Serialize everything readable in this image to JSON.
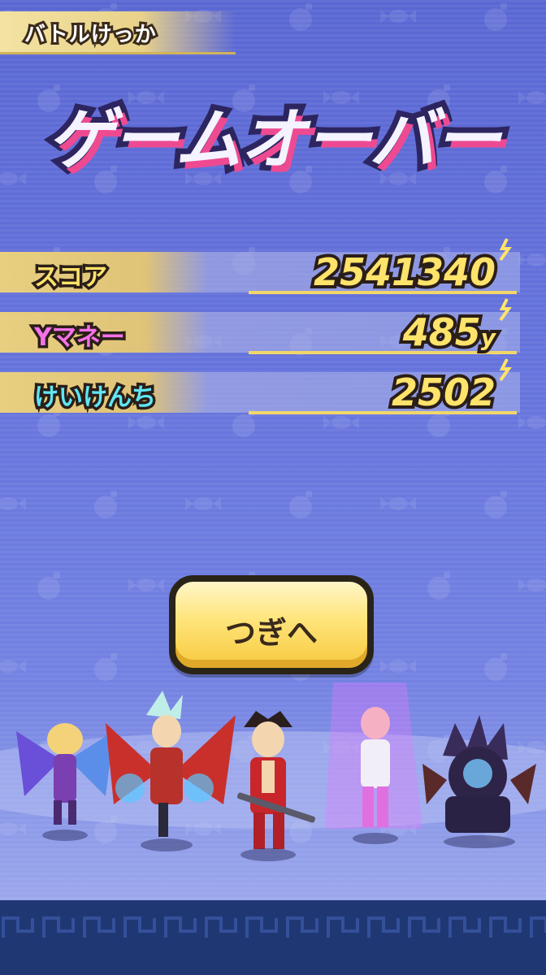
{
  "header": {
    "title": "バトルけっか"
  },
  "result": {
    "title": "ゲームオーバー"
  },
  "stats": [
    {
      "label": "スコア",
      "value": "2541340",
      "unit": "",
      "label_color": "#ffe36a"
    },
    {
      "label": "Yマネー",
      "value": "485",
      "unit": "y",
      "label_color": "#f472e8"
    },
    {
      "label": "けいけんち",
      "value": "2502",
      "unit": "",
      "label_color": "#5fe6f4"
    }
  ],
  "next_button": {
    "label": "つぎへ"
  },
  "colors": {
    "accent_gold": "#ffe36a",
    "title_shadow": "#ee4a92",
    "background": "#5f6fd6",
    "floor": "#1f3773"
  },
  "characters": [
    {
      "name": "winged-sorceress-icon"
    },
    {
      "name": "dragon-winged-warrior-icon"
    },
    {
      "name": "red-swordsman-icon"
    },
    {
      "name": "pink-aura-fighter-icon"
    },
    {
      "name": "dark-spiked-beast-icon"
    }
  ]
}
